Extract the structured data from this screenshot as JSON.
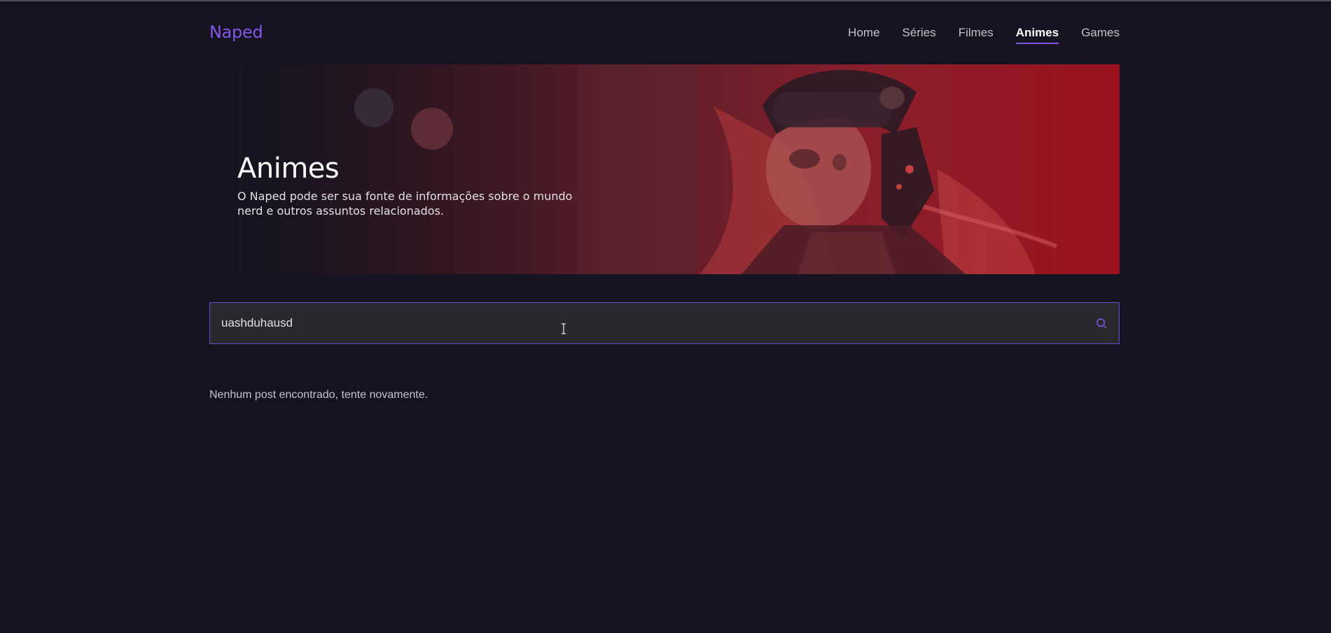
{
  "header": {
    "logo": "Naped",
    "nav": [
      {
        "label": "Home",
        "active": false
      },
      {
        "label": "Séries",
        "active": false
      },
      {
        "label": "Filmes",
        "active": false
      },
      {
        "label": "Animes",
        "active": true
      },
      {
        "label": "Games",
        "active": false
      }
    ]
  },
  "banner": {
    "title": "Animes",
    "description": "O Naped pode ser sua fonte de informações sobre o mundo nerd e outros assuntos relacionados."
  },
  "search": {
    "value": "uashduhausd",
    "icon": "search-icon"
  },
  "results": {
    "empty_message": "Nenhum post encontrado, tente novamente."
  },
  "colors": {
    "background": "#14131f",
    "accent": "#8257e5",
    "input_bg": "#29282f",
    "banner_red": "#9a121e"
  }
}
